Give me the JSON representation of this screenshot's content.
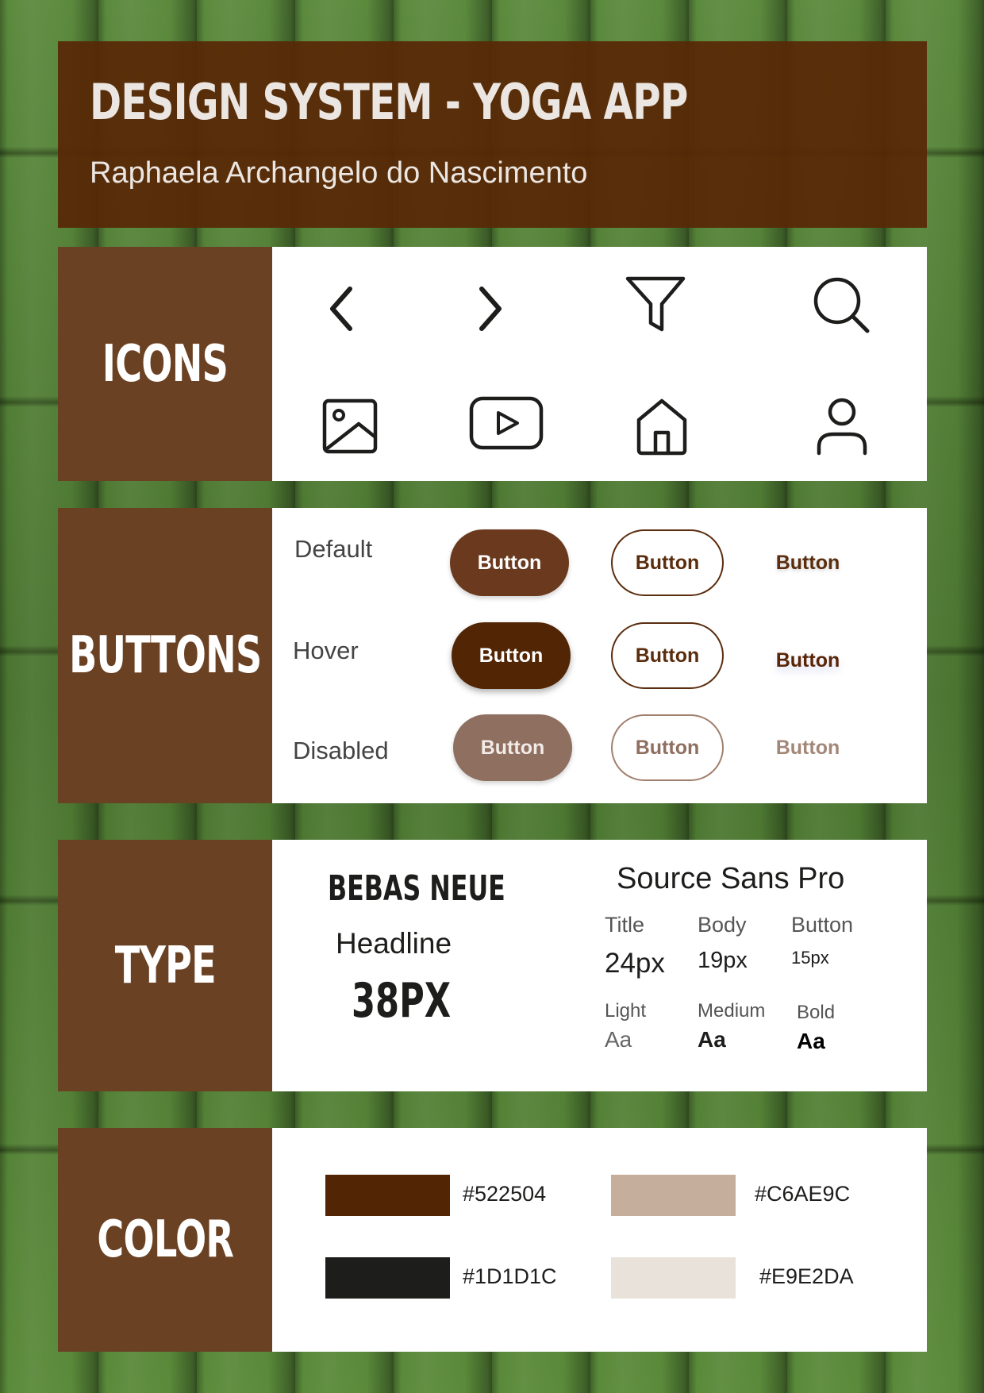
{
  "header": {
    "title": "DESIGN SYSTEM - YOGA APP",
    "subtitle": "Raphaela Archangelo do Nascimento"
  },
  "icons_section": {
    "label": "ICONS",
    "icons": [
      "chevron-left-icon",
      "chevron-right-icon",
      "filter-icon",
      "search-icon",
      "image-icon",
      "video-play-icon",
      "home-icon",
      "user-icon"
    ]
  },
  "buttons_section": {
    "label": "BUTTONS",
    "states": {
      "default": "Default",
      "hover": "Hover",
      "disabled": "Disabled"
    },
    "button_label": "Button"
  },
  "type_section": {
    "label": "TYPE",
    "headline_font": "BEBAS NEUE",
    "headline_label": "Headline",
    "headline_size": "38PX",
    "body_font": "Source Sans Pro",
    "sizes": [
      {
        "label": "Title",
        "value": "24px"
      },
      {
        "label": "Body",
        "value": "19px"
      },
      {
        "label": "Button",
        "value": "15px"
      }
    ],
    "weights": [
      {
        "label": "Light",
        "sample": "Aa"
      },
      {
        "label": "Medium",
        "sample": "Aa"
      },
      {
        "label": "Bold",
        "sample": "Aa"
      }
    ]
  },
  "color_section": {
    "label": "COLOR",
    "colors": [
      {
        "hex": "#522504"
      },
      {
        "hex": "#C6AE9C"
      },
      {
        "hex": "#1D1D1C"
      },
      {
        "hex": "#E9E2DA"
      }
    ]
  },
  "colors": {
    "header_bg": "#582806",
    "label_bg": "#6b4123",
    "accent": "#522504"
  }
}
